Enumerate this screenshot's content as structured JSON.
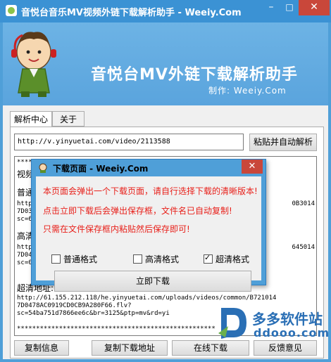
{
  "window": {
    "title": "音悦台音乐MV视频外链下载解析助手 - Weeiy.Com",
    "controls": {
      "minimize": "–",
      "maximize": "□",
      "close": "✕"
    }
  },
  "banner": {
    "title": "音悦台MV外链下载解析助手",
    "credit": "制作: Weeiy.Com"
  },
  "tabs": [
    {
      "label": "解析中心",
      "active": true
    },
    {
      "label": "关于",
      "active": false
    }
  ],
  "url_input": {
    "value": "http://v.yinyuetai.com/video/2113588"
  },
  "parse_button": "粘贴并自动解析",
  "result": {
    "stars_top": "****************************************************",
    "video_label": "视频",
    "normal_label": "普通",
    "normal_line1": "http",
    "normal_line1_right": "0B3014",
    "normal_line2": "7D03",
    "normal_line3": "sc=6",
    "hd_label": "高清",
    "hd_line1": "http",
    "hd_line1_right": "645014",
    "hd_line2": "7D04",
    "hd_line3": "sc=0",
    "super_label": "超清地址:",
    "super_line1": "http://61.155.212.118/he.yinyuetai.com/uploads/videos/common/B721014",
    "super_line2": "7D0478AC0919CD0CB9A280F66.flv?",
    "super_line3": "sc=54ba751d7866ee6c&br=3125&ptp=mv&rd=yi",
    "stars_bottom": "****************************************************"
  },
  "bottom_buttons": {
    "copy_info": "复制信息",
    "copy_download": "复制下载地址",
    "online_download": "在线下载",
    "feedback": "反馈意见"
  },
  "dialog": {
    "title": "下载页面 - Weeiy.Com",
    "messages": [
      "本页面会弹出一个下载页面，请自行选择下载的清晰版本!",
      "点击立即下载后会弹出保存框，文件名已自动复制!",
      "只需在文件保存框内粘贴然后保存即可!"
    ],
    "checkboxes": [
      {
        "label": "普通格式",
        "checked": false
      },
      {
        "label": "高清格式",
        "checked": false
      },
      {
        "label": "超清格式",
        "checked": true
      }
    ],
    "download_button": "立即下载",
    "close": "✕"
  },
  "watermark": {
    "name": "多多软件站",
    "domain": "ddooo.com"
  },
  "colors": {
    "titlebar": "#3b92d4",
    "window_frame": "#4f9fd8",
    "close_red": "#c9473a",
    "message_red": "#e8201a",
    "watermark_blue": "#2a6fb5"
  }
}
